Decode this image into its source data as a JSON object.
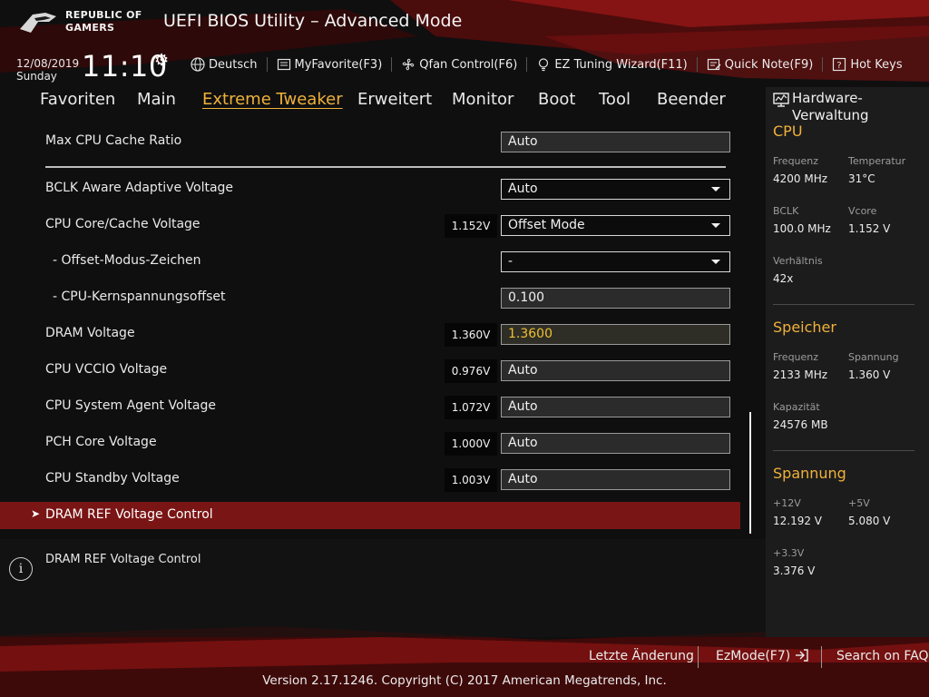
{
  "header": {
    "logo_line1": "REPUBLIC OF",
    "logo_line2": "GAMERS",
    "title": "UEFI BIOS Utility – Advanced Mode",
    "date": "12/08/2019",
    "day": "Sunday",
    "time": "11:10",
    "toolbar": {
      "language": "Deutsch",
      "myfavorite": "MyFavorite(F3)",
      "qfan": "Qfan Control(F6)",
      "ez_tuning": "EZ Tuning Wizard(F11)",
      "quick_note": "Quick Note(F9)",
      "hot_keys": "Hot Keys"
    }
  },
  "nav": {
    "tabs": [
      "Favoriten",
      "Main",
      "Extreme Tweaker",
      "Erweitert",
      "Monitor",
      "Boot",
      "Tool",
      "Beender"
    ],
    "active": "Extreme Tweaker"
  },
  "settings": [
    {
      "label": "Max CPU Cache Ratio",
      "voltage": "",
      "value": "Auto",
      "kind": "text"
    },
    {
      "label": "BCLK Aware Adaptive Voltage",
      "voltage": "",
      "value": "Auto",
      "kind": "dropdown"
    },
    {
      "label": "CPU Core/Cache Voltage",
      "voltage": "1.152V",
      "value": "Offset Mode",
      "kind": "dropdown"
    },
    {
      "label": "- Offset-Modus-Zeichen",
      "voltage": "",
      "value": "-",
      "kind": "dropdown"
    },
    {
      "label": "- CPU-Kernspannungsoffset",
      "voltage": "",
      "value": "0.100",
      "kind": "text"
    },
    {
      "label": "DRAM Voltage",
      "voltage": "1.360V",
      "value": "1.3600",
      "kind": "text"
    },
    {
      "label": "CPU VCCIO Voltage",
      "voltage": "0.976V",
      "value": "Auto",
      "kind": "text"
    },
    {
      "label": "CPU System Agent Voltage",
      "voltage": "1.072V",
      "value": "Auto",
      "kind": "text"
    },
    {
      "label": "PCH Core Voltage",
      "voltage": "1.000V",
      "value": "Auto",
      "kind": "text"
    },
    {
      "label": "CPU Standby Voltage",
      "voltage": "1.003V",
      "value": "Auto",
      "kind": "text"
    }
  ],
  "selected_item": "DRAM REF Voltage Control",
  "info_text": "DRAM REF Voltage Control",
  "hardware": {
    "title": "Hardware-Verwaltung",
    "cpu": {
      "heading": "CPU",
      "freq_label": "Frequenz",
      "freq": "4200 MHz",
      "temp_label": "Temperatur",
      "temp": "31°C",
      "bclk_label": "BCLK",
      "bclk": "100.0 MHz",
      "vcore_label": "Vcore",
      "vcore": "1.152 V",
      "ratio_label": "Verhältnis",
      "ratio": "42x"
    },
    "memory": {
      "heading": "Speicher",
      "freq_label": "Frequenz",
      "freq": "2133 MHz",
      "volt_label": "Spannung",
      "volt": "1.360 V",
      "cap_label": "Kapazität",
      "cap": "24576 MB"
    },
    "voltage": {
      "heading": "Spannung",
      "v12_label": "+12V",
      "v12": "12.192 V",
      "v5_label": "+5V",
      "v5": "5.080 V",
      "v33_label": "+3.3V",
      "v33": "3.376 V"
    }
  },
  "footer": {
    "last_change": "Letzte Änderung",
    "ezmode": "EzMode(F7)",
    "faq": "Search on FAQ",
    "copyright": "Version 2.17.1246. Copyright (C) 2017 American Megatrends, Inc."
  },
  "colors": {
    "accent": "#f0b13a",
    "selected_row": "#7a1515",
    "highlight_value": "#f0c030"
  }
}
